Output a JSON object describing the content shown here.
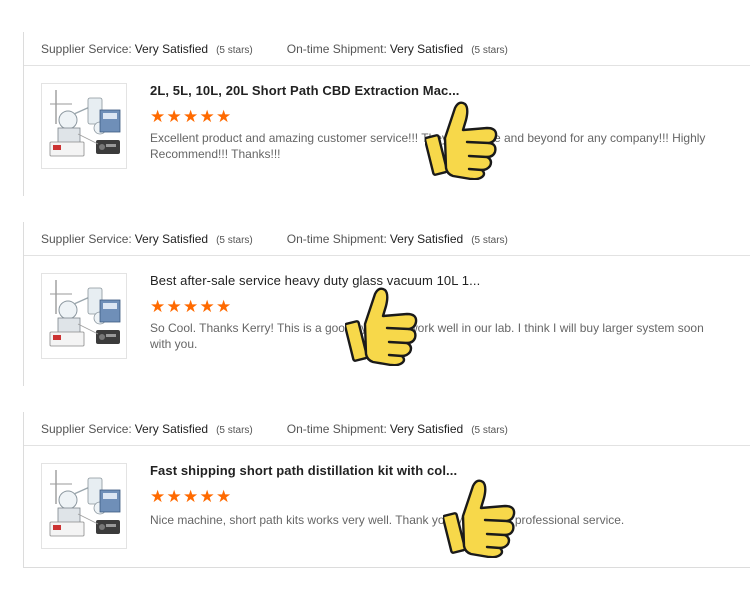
{
  "reviews": [
    {
      "supplier_label": "Supplier Service:",
      "supplier_value": "Very Satisfied",
      "supplier_stars": "(5 stars)",
      "shipment_label": "On-time Shipment:",
      "shipment_value": "Very Satisfied",
      "shipment_stars": "(5 stars)",
      "product_title": "2L, 5L, 10L, 20L Short Path CBD Extraction Mac...",
      "star_count": 5,
      "text": "Excellent product and amazing customer service!!! They go above and beyond for any company!!! Highly Recommend!!! Thanks!!!"
    },
    {
      "supplier_label": "Supplier Service:",
      "supplier_value": "Very Satisfied",
      "supplier_stars": "(5 stars)",
      "shipment_label": "On-time Shipment:",
      "shipment_value": "Very Satisfied",
      "shipment_stars": "(5 stars)",
      "product_title": "Best after-sale service heavy duty glass vacuum 10L 1...",
      "star_count": 5,
      "text": "So Cool. Thanks Kerry! This is a good system, it work well in our lab. I think I will buy larger system soon with you."
    },
    {
      "supplier_label": "Supplier Service:",
      "supplier_value": "Very Satisfied",
      "supplier_stars": "(5 stars)",
      "shipment_label": "On-time Shipment:",
      "shipment_value": "Very Satisfied",
      "shipment_stars": "(5 stars)",
      "product_title": "Fast shipping short path distillation kit with col...",
      "star_count": 5,
      "text": "Nice machine, short path kits works very well. Thank you Mr. Kerry's professional service."
    }
  ],
  "colors": {
    "star": "#ff6a00",
    "thumbs_up_fill": "#f7d84a",
    "thumbs_up_outline": "#1a1a1a"
  },
  "icons": {
    "star": "star-icon",
    "sticker": "thumbs-up-icon"
  }
}
